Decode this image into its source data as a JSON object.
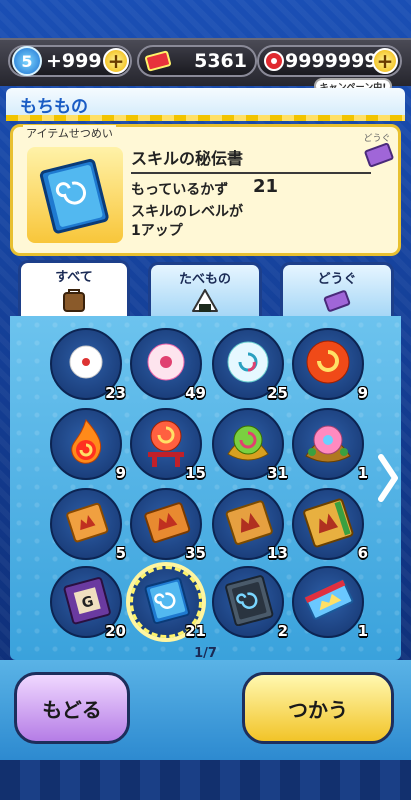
{
  "status": {
    "life": "5",
    "life_count": "+999",
    "points": "5361",
    "money": "9999999",
    "campaign": "キャンペーン中!"
  },
  "header": {
    "title": "もちもの"
  },
  "detail": {
    "section_label": "アイテムせつめい",
    "name": "スキルの秘伝書",
    "count_label": "もっているかず",
    "count": "21",
    "description": "スキルのレベルが\n1アップ",
    "category": "どうぐ"
  },
  "tabs": [
    {
      "label": "すべて",
      "icon": "bag-icon",
      "active": true
    },
    {
      "label": "たべもの",
      "icon": "onigiri-icon",
      "active": false
    },
    {
      "label": "どうぐ",
      "icon": "ticket-icon",
      "active": false
    }
  ],
  "items": [
    {
      "icon": "small-orb-icon",
      "count": "23"
    },
    {
      "icon": "pink-orb-icon",
      "count": "49"
    },
    {
      "icon": "swirl-orb-icon",
      "count": "25"
    },
    {
      "icon": "red-orb-icon",
      "count": "9"
    },
    {
      "icon": "fire-orb-icon",
      "count": "9"
    },
    {
      "icon": "shrine-orb-icon",
      "count": "15"
    },
    {
      "icon": "gold-orb-icon",
      "count": "31"
    },
    {
      "icon": "jeweled-orb-icon",
      "count": "1"
    },
    {
      "icon": "book-red-icon",
      "count": "5"
    },
    {
      "icon": "book-orange-icon",
      "count": "35"
    },
    {
      "icon": "book-gold-icon",
      "count": "13"
    },
    {
      "icon": "book-deluxe-icon",
      "count": "6"
    },
    {
      "icon": "book-purple-icon",
      "count": "20"
    },
    {
      "icon": "book-blue-icon",
      "count": "21",
      "selected": true
    },
    {
      "icon": "book-dark-icon",
      "count": "2"
    },
    {
      "icon": "scroll-icon",
      "count": "1"
    }
  ],
  "page": "1/7",
  "buttons": {
    "back": "もどる",
    "use": "つかう"
  },
  "colors": {
    "accent": "#f2c428",
    "panel": "#fff8d6",
    "grid": "#3aa2dc"
  }
}
